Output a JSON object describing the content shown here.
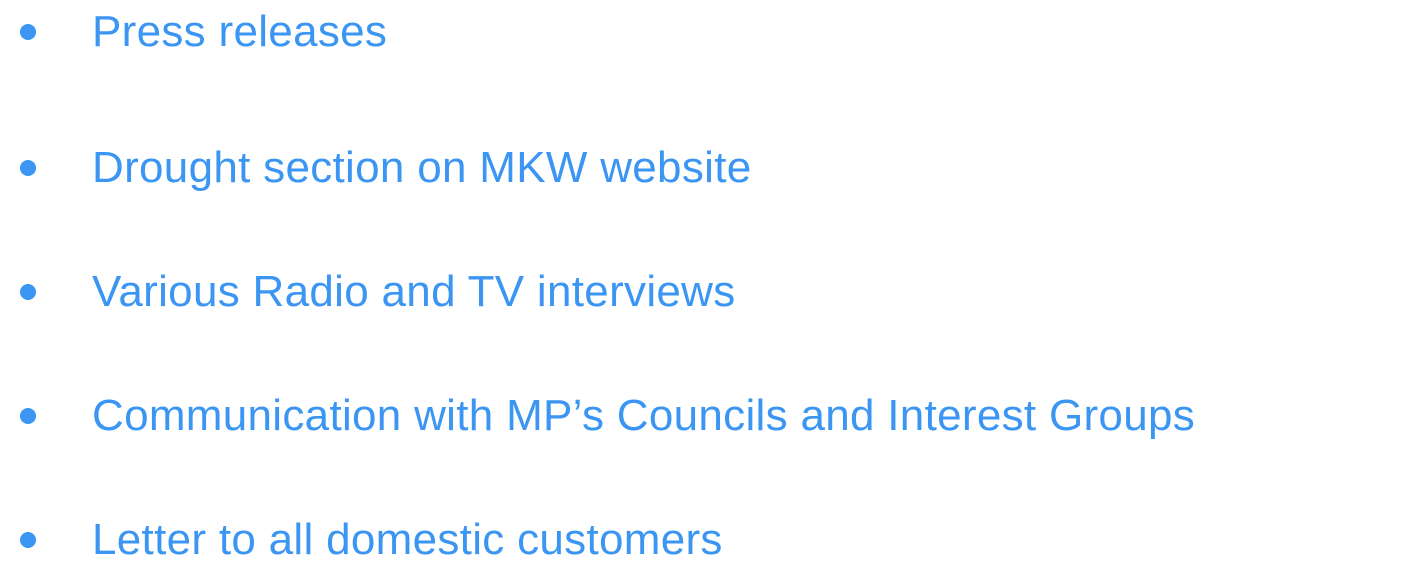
{
  "colors": {
    "text": "#3b95f2",
    "bullet": "#3b95f2",
    "background": "#ffffff"
  },
  "bullets": [
    {
      "text": "Press releases"
    },
    {
      "text": "Drought section on MKW website"
    },
    {
      "text": "Various Radio and TV interviews"
    },
    {
      "text": "Communication with MP’s Councils and Interest Groups"
    },
    {
      "text": "Letter to all domestic customers"
    }
  ]
}
